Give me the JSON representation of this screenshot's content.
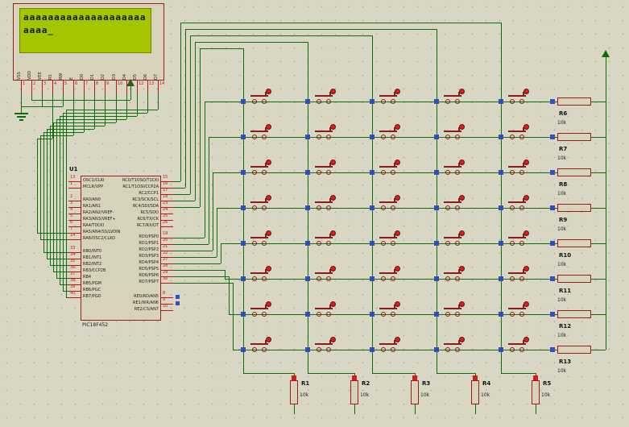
{
  "lcd": {
    "line1": "aaaaaaaaaaaaaaaaaaaa",
    "line2": "aaaa_",
    "pins": [
      {
        "num": "1",
        "label": "VSS"
      },
      {
        "num": "2",
        "label": "VDD"
      },
      {
        "num": "3",
        "label": "VEE"
      },
      {
        "num": "4",
        "label": "RS"
      },
      {
        "num": "5",
        "label": "RW"
      },
      {
        "num": "6",
        "label": "E"
      },
      {
        "num": "7",
        "label": "D0"
      },
      {
        "num": "8",
        "label": "D1"
      },
      {
        "num": "9",
        "label": "D2"
      },
      {
        "num": "10",
        "label": "D3"
      },
      {
        "num": "11",
        "label": "D4"
      },
      {
        "num": "12",
        "label": "D5"
      },
      {
        "num": "13",
        "label": "D6"
      },
      {
        "num": "14",
        "label": "D7"
      }
    ]
  },
  "mcu": {
    "ref": "U1",
    "part": "PIC18F452",
    "left_pins": [
      {
        "num": "13",
        "label": "OSC1/CLKI"
      },
      {
        "num": "1",
        "label": "MCLR/VPP"
      },
      {
        "num": "2",
        "label": "RA0/AN0"
      },
      {
        "num": "3",
        "label": "RA1/AN1"
      },
      {
        "num": "4",
        "label": "RA2/AN2/VREF-"
      },
      {
        "num": "5",
        "label": "RA3/AN3/VREF+"
      },
      {
        "num": "6",
        "label": "RA4/T0CKI"
      },
      {
        "num": "7",
        "label": "RA5/AN4/SS/LVDIN"
      },
      {
        "num": "14",
        "label": "RA6/OSC2/CLKO"
      },
      {
        "num": "33",
        "label": "RB0/INT0"
      },
      {
        "num": "34",
        "label": "RB1/INT1"
      },
      {
        "num": "35",
        "label": "RB2/INT2"
      },
      {
        "num": "36",
        "label": "RB3/CCP2B"
      },
      {
        "num": "37",
        "label": "RB4"
      },
      {
        "num": "38",
        "label": "RB5/PGM"
      },
      {
        "num": "39",
        "label": "RB6/PGC"
      },
      {
        "num": "40",
        "label": "RB7/PGD"
      }
    ],
    "right_pins": [
      {
        "num": "15",
        "label": "RC0/T1OSO/T1CKI"
      },
      {
        "num": "16",
        "label": "RC1/T1OSI/CCP2A"
      },
      {
        "num": "17",
        "label": "RC2/CCP1"
      },
      {
        "num": "18",
        "label": "RC3/SCK/SCL"
      },
      {
        "num": "23",
        "label": "RC4/SDI/SDA"
      },
      {
        "num": "24",
        "label": "RC5/SDO"
      },
      {
        "num": "25",
        "label": "RC6/TX/CK"
      },
      {
        "num": "26",
        "label": "RC7/RX/DT"
      },
      {
        "num": "19",
        "label": "RD0/PSP0"
      },
      {
        "num": "20",
        "label": "RD1/PSP1"
      },
      {
        "num": "21",
        "label": "RD2/PSP2"
      },
      {
        "num": "22",
        "label": "RD3/PSP3"
      },
      {
        "num": "27",
        "label": "RD4/PSP4"
      },
      {
        "num": "28",
        "label": "RD5/PSP5"
      },
      {
        "num": "29",
        "label": "RD6/PSP6"
      },
      {
        "num": "30",
        "label": "RD7/PSP7"
      },
      {
        "num": "8",
        "label": "RE0/RD/AN5"
      },
      {
        "num": "9",
        "label": "RE1/WR/AN6"
      },
      {
        "num": "10",
        "label": "RE2/CS/AN7"
      }
    ]
  },
  "matrix": {
    "rows": 8,
    "cols": 5
  },
  "resistors": {
    "bottom": [
      {
        "ref": "R1",
        "value": "10k"
      },
      {
        "ref": "R2",
        "value": "10k"
      },
      {
        "ref": "R3",
        "value": "10k"
      },
      {
        "ref": "R4",
        "value": "10k"
      },
      {
        "ref": "R5",
        "value": "10k"
      }
    ],
    "right": [
      {
        "ref": "R6",
        "value": "10k"
      },
      {
        "ref": "R7",
        "value": "10k"
      },
      {
        "ref": "R8",
        "value": "10k"
      },
      {
        "ref": "R9",
        "value": "10k"
      },
      {
        "ref": "R10",
        "value": "10k"
      },
      {
        "ref": "R11",
        "value": "10k"
      },
      {
        "ref": "R12",
        "value": "10k"
      },
      {
        "ref": "R13",
        "value": "10k"
      }
    ]
  },
  "colors": {
    "background": "#d9d6c3",
    "wire": "#0c6e0c",
    "pin_red": "#c41414",
    "component_outline": "#9b1c1c",
    "component_fill": "#d7d3ba",
    "lcd_screen": "#a7c400",
    "terminal_blue": "#2f4fc0",
    "terminal_red": "#cf1d1d"
  }
}
